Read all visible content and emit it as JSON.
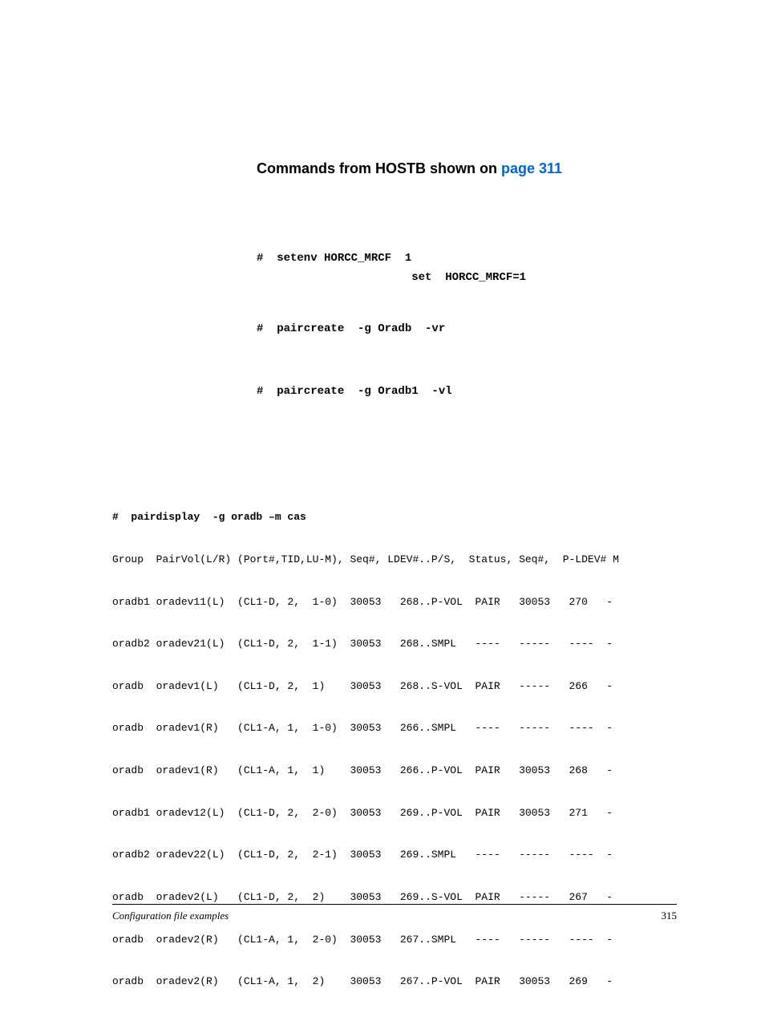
{
  "heading": {
    "prefix": "Commands from HOSTB shown on ",
    "link": "page 311"
  },
  "commands": {
    "setenv": "#  setenv HORCC_MRCF  1",
    "set": "                       set  HORCC_MRCF=1",
    "paircreate_vr": "#  paircreate  -g Oradb  -vr",
    "paircreate_vl": "#  paircreate  -g Oradb1  -vl"
  },
  "pairdisplay": {
    "command": "#  pairdisplay  -g oradb –m cas",
    "header": "Group  PairVol(L/R) (Port#,TID,LU-M), Seq#, LDEV#..P/S,  Status, Seq#,  P-LDEV# M",
    "rows": [
      "oradb1 oradev11(L)  (CL1-D, 2,  1-0)  30053   268..P-VOL  PAIR   30053   270   -",
      "oradb2 oradev21(L)  (CL1-D, 2,  1-1)  30053   268..SMPL   ----   -----   ----  -",
      "oradb  oradev1(L)   (CL1-D, 2,  1)    30053   268..S-VOL  PAIR   -----   266   -",
      "oradb  oradev1(R)   (CL1-A, 1,  1-0)  30053   266..SMPL   ----   -----   ----  -",
      "oradb  oradev1(R)   (CL1-A, 1,  1)    30053   266..P-VOL  PAIR   30053   268   -",
      "oradb1 oradev12(L)  (CL1-D, 2,  2-0)  30053   269..P-VOL  PAIR   30053   271   -",
      "oradb2 oradev22(L)  (CL1-D, 2,  2-1)  30053   269..SMPL   ----   -----   ----  -",
      "oradb  oradev2(L)   (CL1-D, 2,  2)    30053   269..S-VOL  PAIR   -----   267   -",
      "oradb  oradev2(R)   (CL1-A, 1,  2-0)  30053   267..SMPL   ----   -----   ----  -",
      "oradb  oradev2(R)   (CL1-A, 1,  2)    30053   267..P-VOL  PAIR   30053   269   -"
    ]
  },
  "footer": {
    "text": "Configuration file examples",
    "page": "315"
  }
}
